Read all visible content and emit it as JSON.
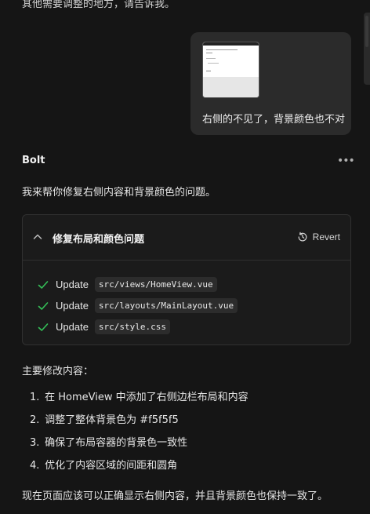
{
  "previous_message_fragment": "其他需要调整的地方，请告诉我。",
  "user_message": {
    "text": "右侧的不见了，背景颜色也不对"
  },
  "assistant": {
    "name": "Bolt",
    "intro": "我来帮你修复右侧内容和背景颜色的问题。",
    "action_card": {
      "title": "修复布局和颜色问题",
      "revert_label": "Revert",
      "updates": [
        {
          "verb": "Update",
          "path": "src/views/HomeView.vue"
        },
        {
          "verb": "Update",
          "path": "src/layouts/MainLayout.vue"
        },
        {
          "verb": "Update",
          "path": "src/style.css"
        }
      ]
    },
    "summary_title": "主要修改内容：",
    "summary_items": [
      {
        "num": "1.",
        "text": "在 HomeView 中添加了右侧边栏布局和内容"
      },
      {
        "num": "2.",
        "text": "调整了整体背景色为 #f5f5f5"
      },
      {
        "num": "3.",
        "text": "确保了布局容器的背景色一致性"
      },
      {
        "num": "4.",
        "text": "优化了内容区域的间距和圆角"
      }
    ],
    "closing": "现在页面应该可以正确显示右侧内容，并且背景颜色也保持一致了。"
  },
  "icons": {
    "more": "more-horizontal-icon",
    "collapse": "chevron-up-icon",
    "revert": "history-icon",
    "check": "check-icon"
  },
  "colors": {
    "background": "#151515",
    "bubble": "#2b2b2b",
    "card": "#1b1b1b",
    "check": "#34c058"
  }
}
